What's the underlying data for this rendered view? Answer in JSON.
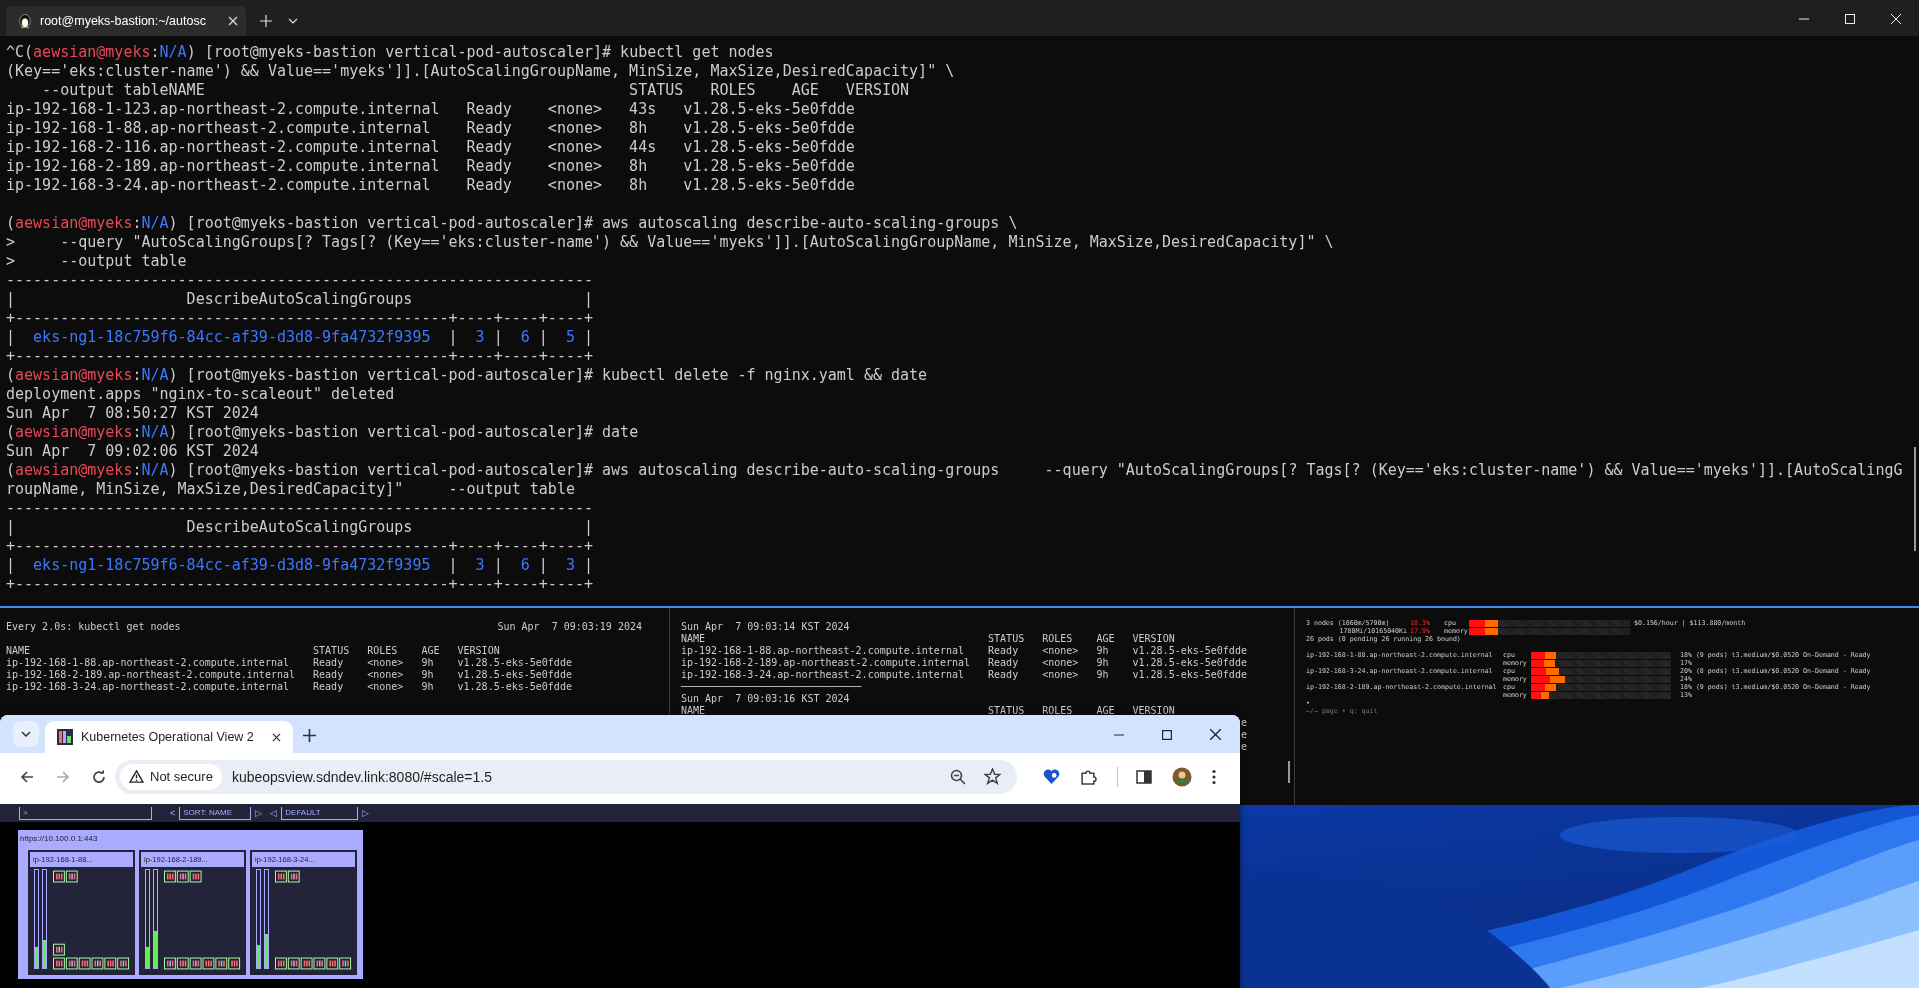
{
  "terminal": {
    "tab": {
      "title": "root@myeks-bastion:~/autosc",
      "selected": true
    },
    "main_pane": {
      "lines": [
        {
          "kind": "output",
          "segments": [
            {
              "text": "^C(",
              "kind": "plain"
            },
            {
              "text": "aewsian@myeks",
              "kind": "user"
            },
            {
              "text": ":",
              "kind": "plain"
            },
            {
              "text": "N/A",
              "kind": "context"
            },
            {
              "text": ") [root@myeks-bastion vertical-pod-autoscaler]# kubectl get nodes",
              "kind": "plain"
            }
          ]
        },
        {
          "kind": "output",
          "segments": [
            {
              "text": "(Key=='eks:cluster-name') && Value=='myeks']].[AutoScalingGroupName, MinSize, MaxSize,DesiredCapacity]\" \\",
              "kind": "plain"
            }
          ]
        },
        {
          "kind": "output",
          "segments": [
            {
              "text": "    --output tableNAME                                               STATUS   ROLES    AGE   VERSION",
              "kind": "plain"
            }
          ]
        },
        {
          "kind": "output",
          "segments": [
            {
              "text": "ip-192-168-1-123.ap-northeast-2.compute.internal   Ready    <none>   43s   v1.28.5-eks-5e0fdde",
              "kind": "plain"
            }
          ]
        },
        {
          "kind": "output",
          "segments": [
            {
              "text": "ip-192-168-1-88.ap-northeast-2.compute.internal    Ready    <none>   8h    v1.28.5-eks-5e0fdde",
              "kind": "plain"
            }
          ]
        },
        {
          "kind": "output",
          "segments": [
            {
              "text": "ip-192-168-2-116.ap-northeast-2.compute.internal   Ready    <none>   44s   v1.28.5-eks-5e0fdde",
              "kind": "plain"
            }
          ]
        },
        {
          "kind": "output",
          "segments": [
            {
              "text": "ip-192-168-2-189.ap-northeast-2.compute.internal   Ready    <none>   8h    v1.28.5-eks-5e0fdde",
              "kind": "plain"
            }
          ]
        },
        {
          "kind": "output",
          "segments": [
            {
              "text": "ip-192-168-3-24.ap-northeast-2.compute.internal    Ready    <none>   8h    v1.28.5-eks-5e0fdde",
              "kind": "plain"
            }
          ]
        },
        {
          "kind": "blank"
        },
        {
          "kind": "output",
          "segments": [
            {
              "text": "(",
              "kind": "plain"
            },
            {
              "text": "aewsian@myeks",
              "kind": "user"
            },
            {
              "text": ":",
              "kind": "plain"
            },
            {
              "text": "N/A",
              "kind": "context"
            },
            {
              "text": ") [root@myeks-bastion vertical-pod-autoscaler]# aws autoscaling describe-auto-scaling-groups \\",
              "kind": "plain"
            }
          ]
        },
        {
          "kind": "output",
          "segments": [
            {
              "text": ">     --query \"AutoScalingGroups[? Tags[? (Key=='eks:cluster-name') && Value=='myeks']].[AutoScalingGroupName, MinSize, MaxSize,DesiredCapacity]\" \\",
              "kind": "plain"
            }
          ]
        },
        {
          "kind": "output",
          "segments": [
            {
              "text": ">     --output table",
              "kind": "plain"
            }
          ]
        },
        {
          "kind": "output",
          "segments": [
            {
              "text": "-----------------------------------------------------------------",
              "kind": "plain"
            }
          ]
        },
        {
          "kind": "output",
          "segments": [
            {
              "text": "|                   DescribeAutoScalingGroups                   |",
              "kind": "plain"
            }
          ]
        },
        {
          "kind": "output",
          "segments": [
            {
              "text": "+------------------------------------------------+----+----+----+",
              "kind": "plain"
            }
          ]
        },
        {
          "kind": "output",
          "segments": [
            {
              "text": "|  ",
              "kind": "plain"
            },
            {
              "text": "eks-ng1-18c759f6-84cc-af39-d3d8-9fa4732f9395",
              "kind": "value"
            },
            {
              "text": "  |  ",
              "kind": "plain"
            },
            {
              "text": "3",
              "kind": "value"
            },
            {
              "text": " |  ",
              "kind": "plain"
            },
            {
              "text": "6",
              "kind": "value"
            },
            {
              "text": " |  ",
              "kind": "plain"
            },
            {
              "text": "5",
              "kind": "value"
            },
            {
              "text": " |",
              "kind": "plain"
            }
          ]
        },
        {
          "kind": "output",
          "segments": [
            {
              "text": "+------------------------------------------------+----+----+----+",
              "kind": "plain"
            }
          ]
        },
        {
          "kind": "output",
          "segments": [
            {
              "text": "(",
              "kind": "plain"
            },
            {
              "text": "aewsian@myeks",
              "kind": "user"
            },
            {
              "text": ":",
              "kind": "plain"
            },
            {
              "text": "N/A",
              "kind": "context"
            },
            {
              "text": ") [root@myeks-bastion vertical-pod-autoscaler]# kubectl delete -f nginx.yaml && date",
              "kind": "plain"
            }
          ]
        },
        {
          "kind": "output",
          "segments": [
            {
              "text": "deployment.apps \"nginx-to-scaleout\" deleted",
              "kind": "plain"
            }
          ]
        },
        {
          "kind": "output",
          "segments": [
            {
              "text": "Sun Apr  7 08:50:27 KST 2024",
              "kind": "plain"
            }
          ]
        },
        {
          "kind": "output",
          "segments": [
            {
              "text": "(",
              "kind": "plain"
            },
            {
              "text": "aewsian@myeks",
              "kind": "user"
            },
            {
              "text": ":",
              "kind": "plain"
            },
            {
              "text": "N/A",
              "kind": "context"
            },
            {
              "text": ") [root@myeks-bastion vertical-pod-autoscaler]# date",
              "kind": "plain"
            }
          ]
        },
        {
          "kind": "output",
          "segments": [
            {
              "text": "Sun Apr  7 09:02:06 KST 2024",
              "kind": "plain"
            }
          ]
        },
        {
          "kind": "output",
          "segments": [
            {
              "text": "(",
              "kind": "plain"
            },
            {
              "text": "aewsian@myeks",
              "kind": "user"
            },
            {
              "text": ":",
              "kind": "plain"
            },
            {
              "text": "N/A",
              "kind": "context"
            },
            {
              "text": ") [root@myeks-bastion vertical-pod-autoscaler]# aws autoscaling describe-auto-scaling-groups     --query \"AutoScalingGroups[? Tags[? (Key=='eks:cluster-name') && Value=='myeks']].[AutoScalingG",
              "kind": "plain"
            }
          ]
        },
        {
          "kind": "output",
          "segments": [
            {
              "text": "roupName, MinSize, MaxSize,DesiredCapacity]\"     --output table",
              "kind": "plain"
            }
          ]
        },
        {
          "kind": "output",
          "segments": [
            {
              "text": "-----------------------------------------------------------------",
              "kind": "plain"
            }
          ]
        },
        {
          "kind": "output",
          "segments": [
            {
              "text": "|                   DescribeAutoScalingGroups                   |",
              "kind": "plain"
            }
          ]
        },
        {
          "kind": "output",
          "segments": [
            {
              "text": "+------------------------------------------------+----+----+----+",
              "kind": "plain"
            }
          ]
        },
        {
          "kind": "output",
          "segments": [
            {
              "text": "|  ",
              "kind": "plain"
            },
            {
              "text": "eks-ng1-18c759f6-84cc-af39-d3d8-9fa4732f9395",
              "kind": "value"
            },
            {
              "text": "  |  ",
              "kind": "plain"
            },
            {
              "text": "3",
              "kind": "value"
            },
            {
              "text": " |  ",
              "kind": "plain"
            },
            {
              "text": "6",
              "kind": "value"
            },
            {
              "text": " |  ",
              "kind": "plain"
            },
            {
              "text": "3",
              "kind": "value"
            },
            {
              "text": " |",
              "kind": "plain"
            }
          ]
        },
        {
          "kind": "output",
          "segments": [
            {
              "text": "+------------------------------------------------+----+----+----+",
              "kind": "plain"
            }
          ]
        }
      ]
    },
    "watch_pane": {
      "command": "Every 2.0s: kubectl get nodes",
      "time": "Sun Apr  7 09:03:19 2024",
      "lines": [
        {
          "kind": "blank"
        },
        {
          "kind": "text",
          "text": "NAME                                               STATUS   ROLES    AGE   VERSION"
        },
        {
          "kind": "text",
          "text": "ip-192-168-1-88.ap-northeast-2.compute.internal    Ready    <none>   9h    v1.28.5-eks-5e0fdde"
        },
        {
          "kind": "text",
          "text": "ip-192-168-2-189.ap-northeast-2.compute.internal   Ready    <none>   9h    v1.28.5-eks-5e0fdde"
        },
        {
          "kind": "text",
          "text": "ip-192-168-3-24.ap-northeast-2.compute.internal    Ready    <none>   9h    v1.28.5-eks-5e0fdde"
        }
      ]
    },
    "loop_pane": {
      "lines": [
        {
          "kind": "text",
          "text": "Sun Apr  7 09:03:14 KST 2024"
        },
        {
          "kind": "text",
          "text": "NAME                                               STATUS   ROLES    AGE   VERSION"
        },
        {
          "kind": "text",
          "text": "ip-192-168-1-88.ap-northeast-2.compute.internal    Ready    <none>   9h    v1.28.5-eks-5e0fdde"
        },
        {
          "kind": "text",
          "text": "ip-192-168-2-189.ap-northeast-2.compute.internal   Ready    <none>   9h    v1.28.5-eks-5e0fdde"
        },
        {
          "kind": "text",
          "text": "ip-192-168-3-24.ap-northeast-2.compute.internal    Ready    <none>   9h    v1.28.5-eks-5e0fdde"
        },
        {
          "kind": "rule",
          "text": "──────────────────────────────"
        },
        {
          "kind": "text",
          "text": "Sun Apr  7 09:03:16 KST 2024"
        },
        {
          "kind": "text",
          "text": "NAME                                               STATUS   ROLES    AGE   VERSION"
        },
        {
          "kind": "cut",
          "text": "e"
        },
        {
          "kind": "cut",
          "text": "e"
        },
        {
          "kind": "cut",
          "text": "e"
        }
      ]
    },
    "node_viewer_pane": {
      "summary": [
        {
          "label": "3 nodes (1060m/5790m)",
          "percent": "18.3%",
          "resource": "cpu",
          "level": 0.18,
          "cost": "$0.156/hour | $113.880/month"
        },
        {
          "label": "1780Mi/10165040Ki",
          "percent": "17.9%",
          "resource": "memory",
          "level": 0.18
        }
      ],
      "pods_line": "26 pods (0 pending 26 running 26 bound)",
      "nodes": [
        {
          "name": "ip-192-168-1-88.ap-northeast-2.compute.internal",
          "resources": [
            {
              "resource": "cpu",
              "level": 0.18,
              "detail": "18% (9 pods) t3.medium/$0.0520 On-Demand - Ready"
            },
            {
              "resource": "memory",
              "level": 0.17,
              "detail": "17%"
            }
          ]
        },
        {
          "name": "ip-192-168-3-24.ap-northeast-2.compute.internal",
          "resources": [
            {
              "resource": "cpu",
              "level": 0.2,
              "detail": "20% (8 pods) t3.medium/$0.0520 On-Demand - Ready"
            },
            {
              "resource": "memory",
              "level": 0.24,
              "detail": "24%"
            }
          ]
        },
        {
          "name": "ip-192-168-2-189.ap-northeast-2.compute.internal",
          "resources": [
            {
              "resource": "cpu",
              "level": 0.18,
              "detail": "18% (9 pods) t3.medium/$0.0520 On-Demand - Ready"
            },
            {
              "resource": "memory",
              "level": 0.13,
              "detail": "13%"
            }
          ]
        }
      ],
      "pager": "•",
      "help": "←/→ page • q: quit"
    }
  },
  "browser": {
    "tabs": [
      {
        "title": "Kubernetes Operational View 2",
        "selected": true
      }
    ],
    "security": "Not secure",
    "url": "kubeopsview.sdndev.link:8080/#scale=1.5",
    "page": {
      "filter": ">",
      "sort_prev": "<",
      "sort": "SORT: NAME",
      "sort_next": "▷",
      "theme_prev": "◁",
      "theme": "DEFAULT",
      "theme_next": "▷",
      "cluster": {
        "url": "https://10.100.0.1:443",
        "nodes": [
          {
            "name": "ip-192-168-1-88...",
            "bars": [
              {
                "level": 0.21
              },
              {
                "level": 0.29
              }
            ]
          },
          {
            "name": "ip-192-168-2-189...",
            "bars": [
              {
                "level": 0.21
              },
              {
                "level": 0.38
              }
            ]
          },
          {
            "name": "ip-192-168-3-24...",
            "bars": [
              {
                "level": 0.23
              },
              {
                "level": 0.35
              }
            ]
          }
        ]
      }
    }
  }
}
